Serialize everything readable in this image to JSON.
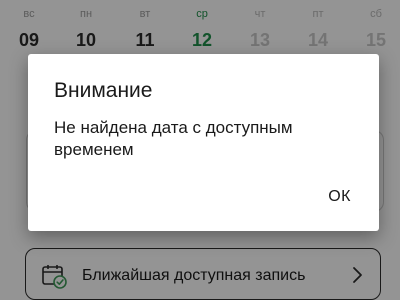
{
  "week": {
    "days": [
      {
        "dow": "вс",
        "num": "09",
        "state": "normal"
      },
      {
        "dow": "пн",
        "num": "10",
        "state": "normal"
      },
      {
        "dow": "вт",
        "num": "11",
        "state": "normal"
      },
      {
        "dow": "ср",
        "num": "12",
        "state": "selected"
      },
      {
        "dow": "чт",
        "num": "13",
        "state": "disabled"
      },
      {
        "dow": "пт",
        "num": "14",
        "state": "disabled"
      },
      {
        "dow": "сб",
        "num": "15",
        "state": "disabled"
      }
    ]
  },
  "nearest": {
    "label": "Ближайшая доступная запись",
    "icon": "calendar-check-icon",
    "chevron_icon": "chevron-right-icon"
  },
  "dialog": {
    "title": "Внимание",
    "message": "Не найдена дата с доступным временем",
    "ok_label": "ОК"
  },
  "colors": {
    "accent": "#1f8f4a",
    "icon_green": "#3f9a58"
  }
}
